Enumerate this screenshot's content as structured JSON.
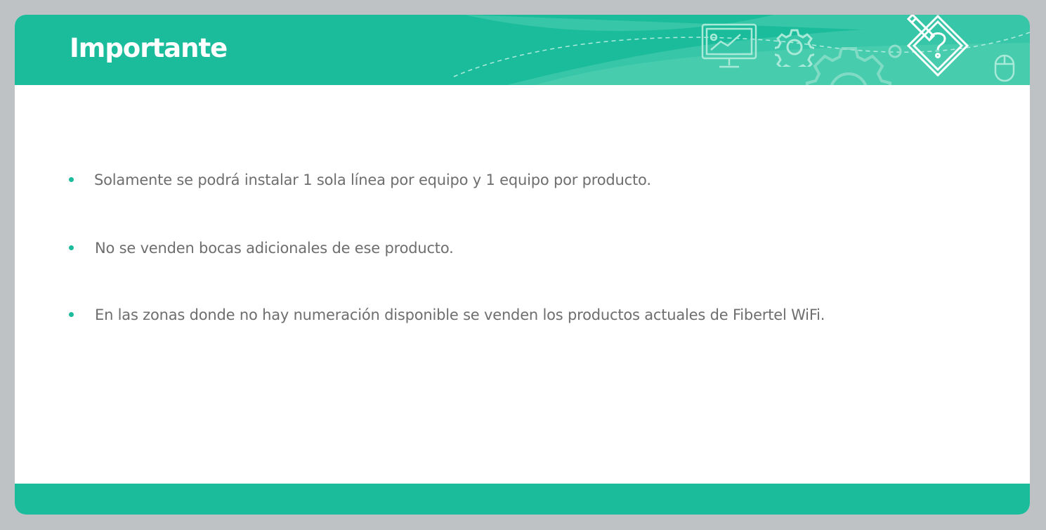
{
  "header": {
    "title": "Importante",
    "icons": [
      "presentation-board-icon",
      "gear-icon",
      "large-gear-icon",
      "pencil-question-icon",
      "mouse-icon"
    ]
  },
  "bullets": [
    {
      "text": "Solamente se podrá instalar 1 sola línea por equipo y 1 equipo por producto."
    },
    {
      "text": "No se venden bocas adicionales de ese producto."
    },
    {
      "text": "En las zonas donde no hay numeración disponible se venden los productos actuales de Fibertel WiFi."
    }
  ],
  "colors": {
    "accent": "#1bbc9b",
    "accent_light": "#4ecdb0",
    "text": "#6e6e6e",
    "background": "#ffffff",
    "frame": "#bfc2c5"
  }
}
